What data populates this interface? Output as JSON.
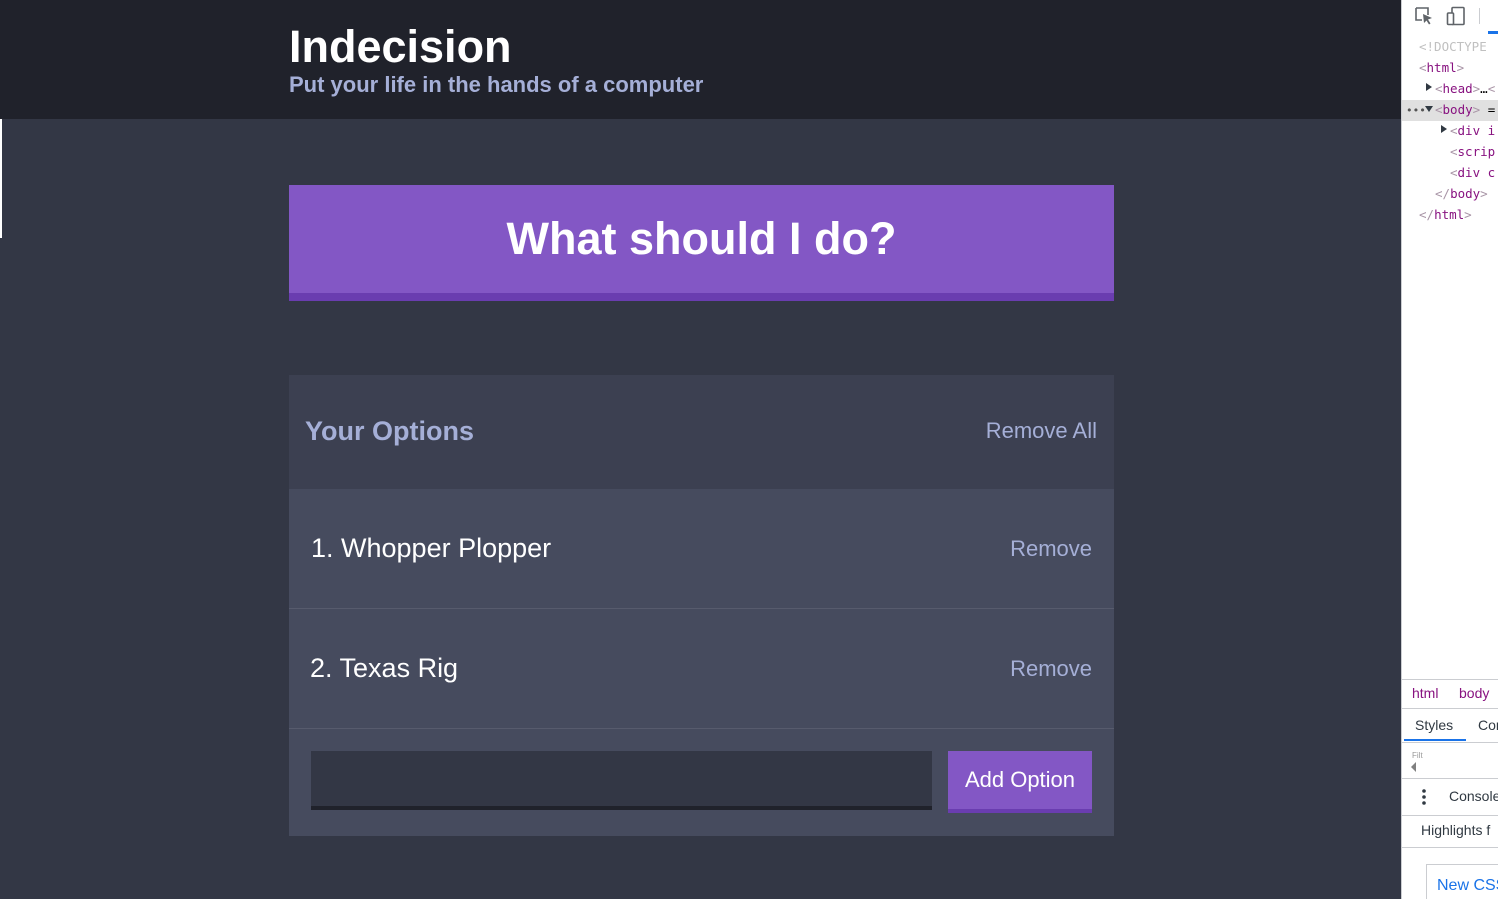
{
  "app": {
    "title": "Indecision",
    "subtitle": "Put your life in the hands of a computer",
    "action_button_label": "What should I do?"
  },
  "options_widget": {
    "header_title": "Your Options",
    "remove_all_label": "Remove All",
    "options": [
      {
        "text": "1. Whopper Plopper",
        "remove_label": "Remove"
      },
      {
        "text": "2. Texas Rig",
        "remove_label": "Remove"
      }
    ],
    "add_input_value": "",
    "add_button_label": "Add Option"
  },
  "devtools": {
    "dom_lines": [
      {
        "parts": [
          [
            "doctype",
            "<!DOCTYPE"
          ]
        ]
      },
      {
        "parts": [
          [
            "brk",
            "<"
          ],
          [
            "tag",
            "html"
          ],
          [
            "brk",
            ">"
          ]
        ]
      },
      {
        "parts": [
          [
            "brk",
            "<"
          ],
          [
            "tag",
            "head"
          ],
          [
            "brk",
            ">"
          ],
          [
            "plain",
            "…"
          ],
          [
            "brk",
            "<"
          ]
        ]
      },
      {
        "parts": [
          [
            "brk",
            "<"
          ],
          [
            "tag",
            "body"
          ],
          [
            "brk",
            ">"
          ],
          [
            "plain",
            " ="
          ]
        ]
      },
      {
        "parts": [
          [
            "brk",
            "<"
          ],
          [
            "tag",
            "div i"
          ]
        ]
      },
      {
        "parts": [
          [
            "brk",
            "<"
          ],
          [
            "tag",
            "scrip"
          ]
        ]
      },
      {
        "parts": [
          [
            "brk",
            "<"
          ],
          [
            "tag",
            "div c"
          ]
        ]
      },
      {
        "parts": [
          [
            "brk",
            "</"
          ],
          [
            "tag",
            "body"
          ],
          [
            "brk",
            ">"
          ]
        ]
      },
      {
        "parts": [
          [
            "brk",
            "</"
          ],
          [
            "tag",
            "html"
          ],
          [
            "brk",
            ">"
          ]
        ]
      }
    ],
    "ellipsis": "•••",
    "breadcrumbs": [
      "html",
      "body"
    ],
    "tabs": [
      "Styles",
      "Cor"
    ],
    "filter_placeholder": "Filt",
    "drawer_tab": "Console",
    "highlights_text": "Highlights f",
    "new_css_button": "New CSS",
    "colors": {
      "tag": "#881280",
      "accent": "#1a73e8"
    }
  },
  "colors": {
    "header_bg": "#20222b",
    "page_bg": "#333745",
    "purple": "#8357c5",
    "purple_dark": "#6a3db0",
    "widget_header_bg": "#3c4051",
    "widget_bg": "#464b5e",
    "muted_text": "#a5afd7"
  }
}
